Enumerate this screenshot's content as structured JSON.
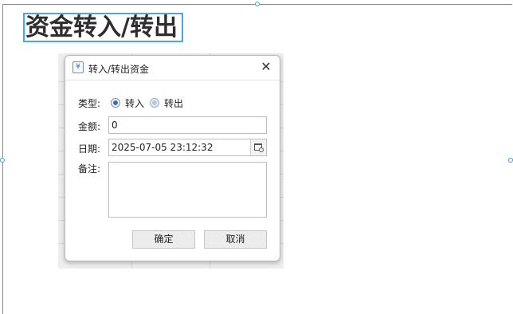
{
  "page": {
    "heading": "资金转入/转出"
  },
  "dialog": {
    "title": "转入/转出资金",
    "app_icon": "yen-icon",
    "close_icon": "close-icon",
    "type_label": "类型:",
    "type_options": [
      {
        "label": "转入",
        "checked": true
      },
      {
        "label": "转出",
        "checked": false
      }
    ],
    "amount_label": "金额:",
    "amount_value": "0",
    "date_label": "日期:",
    "date_value": "2025-07-05 23:12:32",
    "date_picker_icon": "calendar-icon",
    "note_label": "备注:",
    "note_value": "",
    "confirm_label": "确定",
    "cancel_label": "取消"
  },
  "colors": {
    "selection": "#3aa0d8",
    "radio_checked": "#2c6ed5"
  }
}
